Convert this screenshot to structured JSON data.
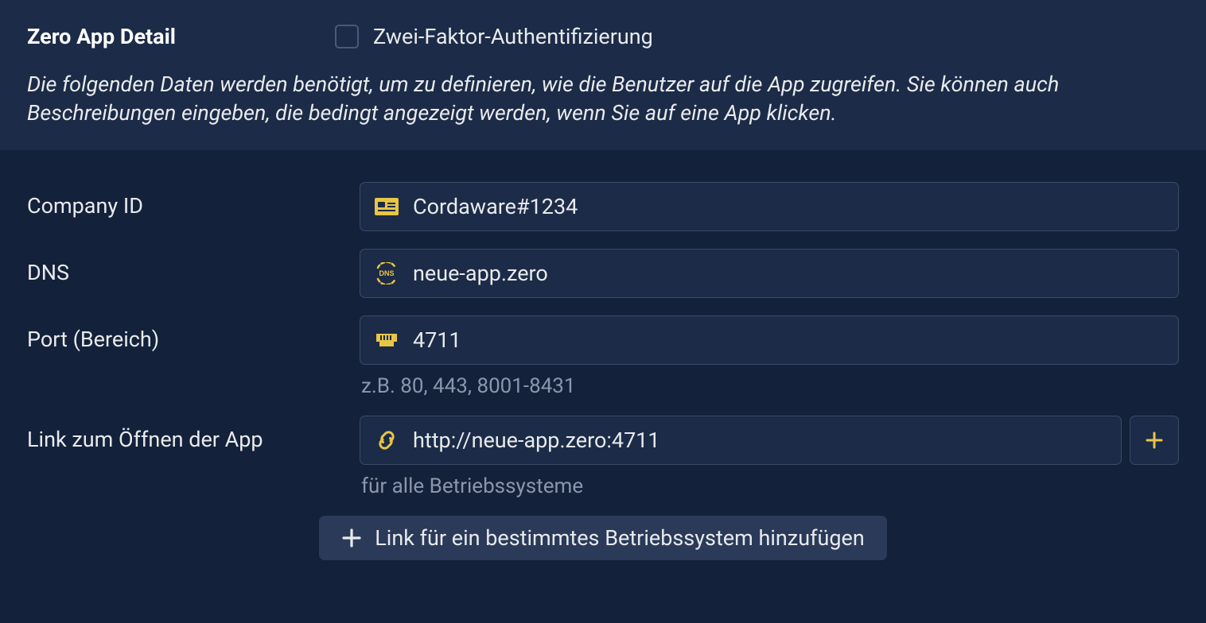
{
  "header": {
    "title": "Zero App Detail",
    "two_factor_label": "Zwei-Faktor-Authentifizierung",
    "description": "Die folgenden Daten werden benötigt, um zu definieren, wie die Benutzer auf die App zugreifen. Sie können auch Beschreibungen eingeben, die bedingt angezeigt werden, wenn Sie auf eine App klicken."
  },
  "fields": {
    "company_id": {
      "label": "Company ID",
      "value": "Cordaware#1234"
    },
    "dns": {
      "label": "DNS",
      "value": "neue-app.zero"
    },
    "port": {
      "label": "Port (Bereich)",
      "value": "4711",
      "helper": "z.B. 80, 443, 8001-8431"
    },
    "link": {
      "label": "Link zum Öffnen der App",
      "value": "http://neue-app.zero:4711",
      "helper": "für alle Betriebssysteme"
    }
  },
  "buttons": {
    "add_os_link": "Link für ein bestimmtes Betriebssystem hinzufügen"
  },
  "colors": {
    "accent": "#e8c547"
  }
}
